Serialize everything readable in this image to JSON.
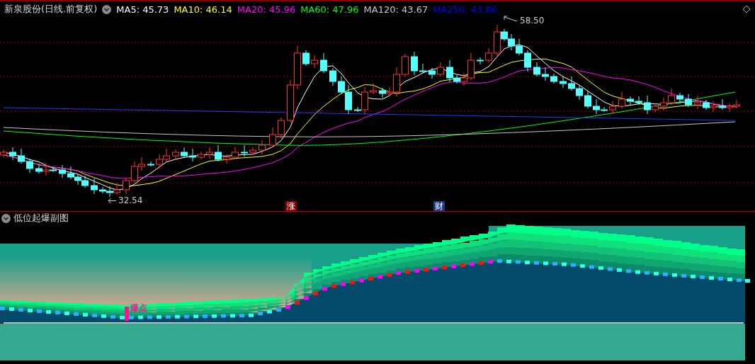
{
  "title": "新泉股份(日线.前复权)",
  "averages": [
    {
      "label": "MA5: 45.73",
      "color": "#ffffff"
    },
    {
      "label": "MA10: 46.14",
      "color": "#ffff00"
    },
    {
      "label": "MA20: 45.96",
      "color": "#ff00ff"
    },
    {
      "label": "MA60: 47.96",
      "color": "#00ff00"
    },
    {
      "label": "MA120: 43.67",
      "color": "#c8c8c8"
    },
    {
      "label": "MA250: 43.86",
      "color": "#0000ff"
    }
  ],
  "price_labels": [
    {
      "text": "58.50",
      "kind": "high"
    },
    {
      "text": "32.54",
      "kind": "low"
    }
  ],
  "event_markers": [
    {
      "text": "涨",
      "color": "#8b0000"
    },
    {
      "text": "财",
      "color": "#1e3a8a"
    }
  ],
  "sub_chart": {
    "title": "低位起爆副图",
    "signal_label": "爆点"
  }
}
